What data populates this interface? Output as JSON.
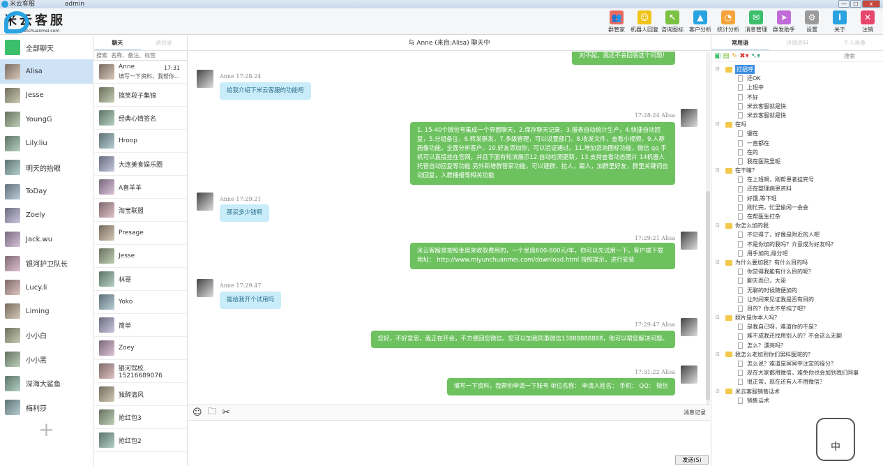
{
  "window": {
    "title": "米云客服",
    "user": "admin",
    "min": "—",
    "max": "□",
    "close": "x"
  },
  "logo": {
    "name": "米云客服",
    "url": "www.miyunchuanmei.com"
  },
  "toolbar": [
    {
      "label": "群管家",
      "icon": "group-icon",
      "color": "#e96a5f",
      "glyph": "👥"
    },
    {
      "label": "机器人回复",
      "icon": "robot-icon",
      "color": "#f0c419",
      "glyph": "☺"
    },
    {
      "label": "咨询图标",
      "icon": "cursor-icon",
      "color": "#7cc242",
      "glyph": "↖"
    },
    {
      "label": "客户分析",
      "icon": "user-chart-icon",
      "color": "#2aa3e0",
      "glyph": "▲"
    },
    {
      "label": "统计分析",
      "icon": "pie-chart-icon",
      "color": "#f5a33b",
      "glyph": "◔"
    },
    {
      "label": "消息管理",
      "icon": "message-icon",
      "color": "#3bbf6a",
      "glyph": "✉"
    },
    {
      "label": "群发助手",
      "icon": "send-icon",
      "color": "#c06bd8",
      "glyph": "➤"
    },
    {
      "label": "设置",
      "icon": "gear-icon",
      "color": "#9a9a9a",
      "glyph": "⚙"
    },
    {
      "label": "关于",
      "icon": "info-icon",
      "color": "#2aa3e0",
      "glyph": "i"
    },
    {
      "label": "注销",
      "icon": "logout-icon",
      "color": "#e8476d",
      "glyph": "✕"
    }
  ],
  "accounts": {
    "all": "全部聊天",
    "items": [
      "Alisa",
      "Jesse",
      "YoungG",
      "Lily.liu",
      "明天的抬眼",
      "ToDay",
      "Zoely",
      "Jack.wu",
      "银河护卫队长",
      "Lucy.li",
      "Liming",
      "小小白",
      "小小黑",
      "深海大鲨鱼",
      "梅利莎"
    ],
    "selected": "Alisa",
    "add": "+"
  },
  "contacts": {
    "tabs": [
      "聊天",
      "通讯录"
    ],
    "search_placeholder": "搜索  名称、备注、标签",
    "items": [
      {
        "name": "Anne",
        "time": "17:31",
        "preview": "填写一下资料，我帮你..."
      },
      {
        "name": "搞笑段子集锦"
      },
      {
        "name": "经典心情签名"
      },
      {
        "name": "Hroop"
      },
      {
        "name": "大连美食娱乐圈"
      },
      {
        "name": "A喜羊羊"
      },
      {
        "name": "淘宝联盟"
      },
      {
        "name": "Presage"
      },
      {
        "name": "Jesse"
      },
      {
        "name": "林哥"
      },
      {
        "name": "Yoko"
      },
      {
        "name": "简单"
      },
      {
        "name": "Zoey"
      },
      {
        "name": "银河驾校15216689076"
      },
      {
        "name": "独醉清风"
      },
      {
        "name": "抢红包3"
      },
      {
        "name": "抢红包2"
      }
    ]
  },
  "chat": {
    "title": "与 Anne (来自:Alisa) 聊天中",
    "messages": [
      {
        "dir": "out",
        "meta": "",
        "text": "对不起，我还不会回答这个问题！"
      },
      {
        "dir": "in",
        "meta": "Anne 17:28:24",
        "text": "给我介绍下米云客服的功能吧"
      },
      {
        "dir": "out",
        "meta": "17:28:24 Alisa",
        "text": "1. 15-40个微信号集成一个界面聊天，2.保存聊天记录，3.报表自动统计生产，4.快捷自动回复，5.分组备注，6.转发群发，7.多级管理，可以设置部门，8.收发文件，查看小视频，9.人群画像功能，全面分析客户。10.好友添加你，可以验证通过。11.增加咨询图标功能，微信 qq 手机可以直接挂在官网，并且下面有轮流展示12.自动检测更新，13.支持查看动态图片 14机器人托管自动回复等功能 另外新增群管家功能，可以建群，拉人，踢人，加群里好友，群里关键词自动回复，入群播报等相关功能"
      },
      {
        "dir": "in",
        "meta": "Anne 17:29:21",
        "text": "那买多少钱啊"
      },
      {
        "dir": "out",
        "meta": "17:29:21 Alisa",
        "text": "米云客服是按照坐席来收取费用的，一个坐席600-800元/年，你可以先试用一下。客户端下载地址： http://www.miyunchuanmei.com/download.html 按照提示，进行安装"
      },
      {
        "dir": "in",
        "meta": "Anne 17:29:47",
        "text": "能给我开个试用吗"
      },
      {
        "dir": "out",
        "meta": "17:29:47 Alisa",
        "text": "您好，不好意思，我正在开会，不方便回您微信。您可以加我同事微信13888888888，他可以帮您解决问题。"
      },
      {
        "dir": "out",
        "meta": "17:31:22 Alisa",
        "text": "填写一下资料，我帮你申请一下账号 单位名称： 申请人姓名： 手机： QQ： 微信"
      }
    ],
    "history": "消息记录",
    "send": "发送(S)",
    "input_value": ""
  },
  "phrases": {
    "tabs": [
      "常用语",
      "详细资料",
      "个人画像"
    ],
    "search_placeholder": "搜索",
    "groups": [
      {
        "name": "打招呼",
        "items": [
          "还OK",
          "上班中",
          "不好",
          "米云客服就是快",
          "米云客服就是快"
        ]
      },
      {
        "name": "在吗",
        "items": [
          "键在",
          "一直都在",
          "在的",
          "我在医院里呢"
        ]
      },
      {
        "name": "在干嘛？",
        "items": [
          "在上班啊，刚帮患者挂完号",
          "还在整理病患资料",
          "好饿,等下班",
          "刚忙完，忙里偷闲一会会",
          "在帮医生打杂"
        ]
      },
      {
        "name": "你怎么加的我",
        "items": [
          "不记得了，好像是附近的人吧",
          "不是你加的我吗？介意成为好友吗？",
          "用手加的,缘分吧"
        ]
      },
      {
        "name": "为什么要加我？有什么目的吗",
        "items": [
          "你觉得我能有什么目的呢？",
          "聊天而已，大哥",
          "无聊的时候随便加的",
          "让时间来见证我是否有目的",
          "目的？你太不单纯了吧？"
        ]
      },
      {
        "name": "照片是你本人吗？",
        "items": [
          "是我自己呀，难道你的不是？",
          "难不成我还找用别人的？不会这么无聊",
          "怎么？漂亮吗？"
        ]
      },
      {
        "name": "我怎么老加到你们男科医院的？",
        "items": [
          "怎么说？难道是冥冥中注定的缘分？",
          "现在大家都用微信，难免你也会加到我们同事",
          "很正常，现在还有人不用微信？"
        ]
      },
      {
        "name": "米云客服销售话术",
        "items": [
          "销售话术"
        ]
      }
    ]
  },
  "mascot": "中"
}
